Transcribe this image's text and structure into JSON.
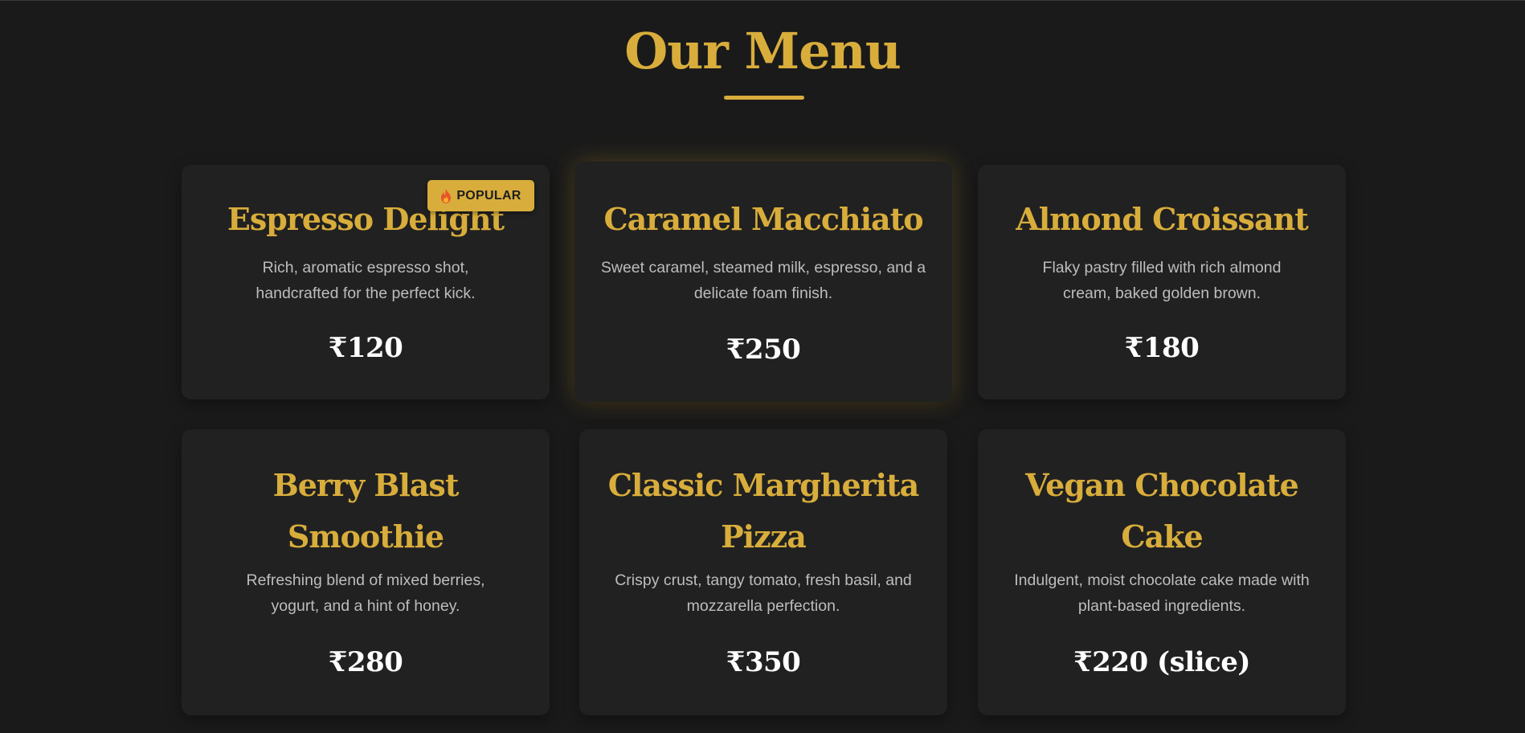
{
  "page": {
    "title": "Our Menu"
  },
  "badge": {
    "label": "POPULAR",
    "icon": "fire-icon"
  },
  "colors": {
    "background": "#1a1a1a",
    "card": "#212121",
    "accent": "#d8ad3b",
    "text_muted": "#bdbdbd",
    "price": "#ffffff"
  },
  "menu": {
    "items": [
      {
        "name": "Espresso Delight",
        "description": "Rich, aromatic espresso shot, handcrafted for the perfect kick.",
        "price": "₹120",
        "badge": "POPULAR"
      },
      {
        "name": "Caramel Macchiato",
        "description": "Sweet caramel, steamed milk, espresso, and a delicate foam finish.",
        "price": "₹250"
      },
      {
        "name": "Almond Croissant",
        "description": "Flaky pastry filled with rich almond cream, baked golden brown.",
        "price": "₹180"
      },
      {
        "name": "Berry Blast Smoothie",
        "description": "Refreshing blend of mixed berries, yogurt, and a hint of honey.",
        "price": "₹280"
      },
      {
        "name": "Classic Margherita Pizza",
        "description": "Crispy crust, tangy tomato, fresh basil, and mozzarella perfection.",
        "price": "₹350"
      },
      {
        "name": "Vegan Chocolate Cake",
        "description": "Indulgent, moist chocolate cake made with plant-based ingredients.",
        "price": "₹220 (slice)"
      }
    ]
  }
}
